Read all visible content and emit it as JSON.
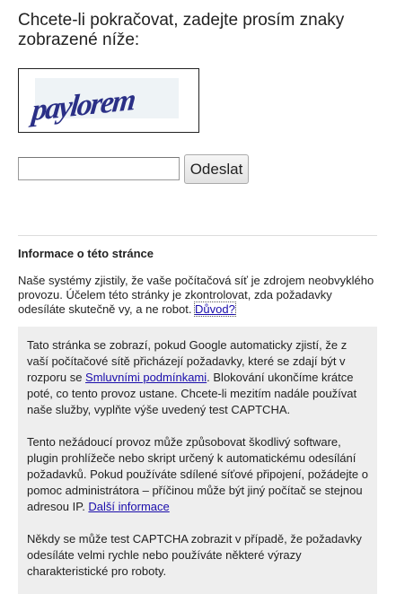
{
  "heading": "Chcete-li pokračovat, zadejte prosím znaky zobrazené níže:",
  "captcha": {
    "text": "paylorem",
    "ink_color": "#2a2f86"
  },
  "form": {
    "input_value": "",
    "submit_label": "Odeslat"
  },
  "info": {
    "title": "Informace o této stránce",
    "intro_text": "Naše systémy zjistily, že vaše počítačová síť je zdrojem neobvyklého provozu. Účelem této stránky je zkontrolovat, zda požadavky odesíláte skutečně vy, a ne robot. ",
    "intro_link": "Důvod?"
  },
  "details": {
    "p1_before": "Tato stránka se zobrazí, pokud Google automaticky zjistí, že z vaší počítačové sítě přicházejí požadavky, které se zdají být v rozporu se ",
    "p1_link": "Smluvními podmínkami",
    "p1_after": ". Blokování ukončíme krátce poté, co tento provoz ustane. Chcete-li mezitím nadále používat naše služby, vyplňte výše uvedený test CAPTCHA.",
    "p2_before": "Tento nežádoucí provoz může způsobovat škodlivý software, plugin prohlížeče nebo skript určený k automatickému odesílání požadavků. Pokud používáte sdílené síťové připojení, požádejte o pomoc administrátora – příčinou může být jiný počítač se stejnou adresou IP. ",
    "p2_link": "Další informace",
    "p3": "Někdy se může test CAPTCHA zobrazit v případě, že požadavky odesíláte velmi rychle nebo používáte některé výrazy charakteristické pro roboty."
  },
  "colors": {
    "link": "#1a0dab",
    "gray_box": "#eeeeee"
  }
}
